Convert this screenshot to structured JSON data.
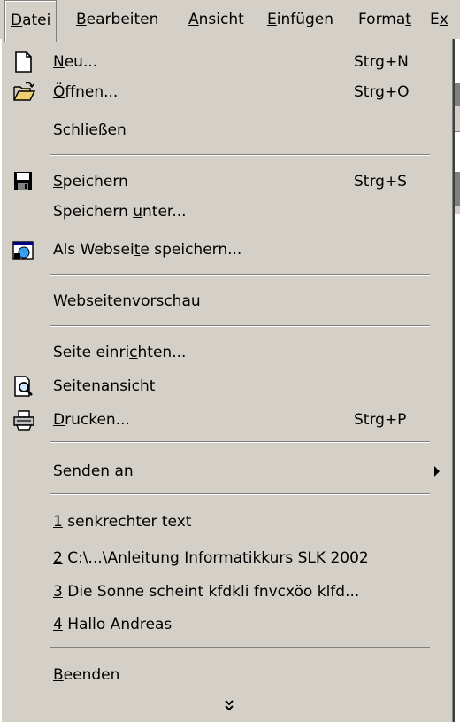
{
  "menubar": {
    "items": [
      {
        "pre": "",
        "acc": "D",
        "post": "atei"
      },
      {
        "pre": "",
        "acc": "B",
        "post": "earbeiten"
      },
      {
        "pre": "",
        "acc": "A",
        "post": "nsicht"
      },
      {
        "pre": "",
        "acc": "E",
        "post": "infügen"
      },
      {
        "pre": "Forma",
        "acc": "t",
        "post": ""
      },
      {
        "pre": "E",
        "acc": "x",
        "post": ""
      }
    ]
  },
  "menu": {
    "items": [
      {
        "pre": "",
        "acc": "N",
        "post": "eu...",
        "shortcut": "Strg+N",
        "icon": "new-document-icon"
      },
      {
        "pre": "",
        "acc": "Ö",
        "post": "ffnen...",
        "shortcut": "Strg+O",
        "icon": "open-folder-icon"
      },
      {
        "pre": "S",
        "acc": "c",
        "post": "hließen",
        "shortcut": ""
      },
      {
        "pre": "",
        "acc": "S",
        "post": "peichern",
        "shortcut": "Strg+S",
        "icon": "save-disk-icon"
      },
      {
        "pre": "Speichern ",
        "acc": "u",
        "post": "nter...",
        "shortcut": ""
      },
      {
        "pre": "Als Websei",
        "acc": "t",
        "post": "e speichern...",
        "shortcut": "",
        "icon": "web-page-icon"
      },
      {
        "pre": "",
        "acc": "W",
        "post": "ebseitenvorschau",
        "shortcut": ""
      },
      {
        "pre": "Seite einri",
        "acc": "c",
        "post": "hten...",
        "shortcut": ""
      },
      {
        "pre": "Seitenansic",
        "acc": "h",
        "post": "t",
        "shortcut": "",
        "icon": "print-preview-icon"
      },
      {
        "pre": "",
        "acc": "D",
        "post": "rucken...",
        "shortcut": "Strg+P",
        "icon": "printer-icon"
      },
      {
        "pre": "S",
        "acc": "e",
        "post": "nden an",
        "shortcut": "",
        "submenu": true
      },
      {
        "pre": "",
        "acc": "1",
        "post": " senkrechter text",
        "shortcut": ""
      },
      {
        "pre": "",
        "acc": "2",
        "post": " C:\\...\\Anleitung Informatikkurs SLK 2002",
        "shortcut": ""
      },
      {
        "pre": "",
        "acc": "3",
        "post": " Die Sonne scheint kfdkli fnvcxöo klfd...",
        "shortcut": ""
      },
      {
        "pre": "",
        "acc": "4",
        "post": " Hallo  Andreas",
        "shortcut": ""
      },
      {
        "pre": "",
        "acc": "B",
        "post": "eenden",
        "shortcut": ""
      }
    ],
    "expand_icon": "double-chevron-down-icon"
  }
}
